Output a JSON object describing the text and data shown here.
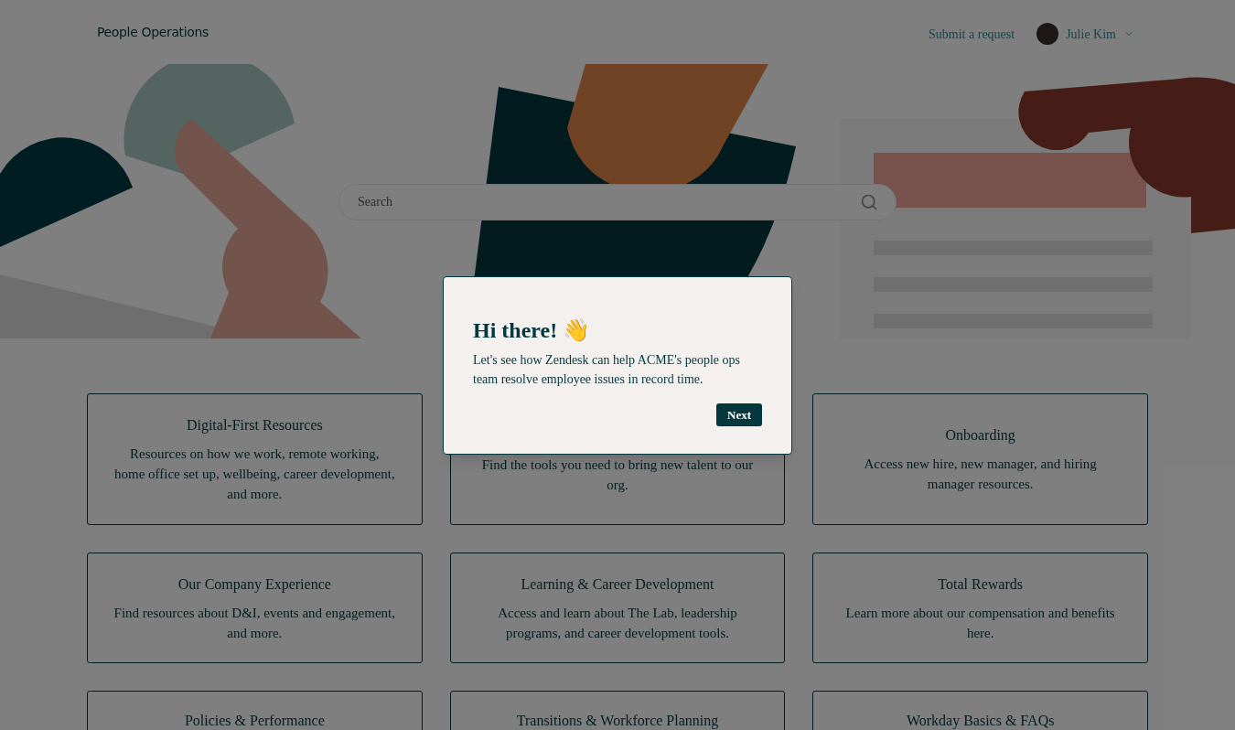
{
  "header": {
    "logo": "People Operations",
    "links": [
      {
        "label": "Submit a request"
      }
    ],
    "user": {
      "name": "Julie Kim"
    }
  },
  "search": {
    "placeholder": "Search"
  },
  "categories": [
    {
      "title": "Digital-First Resources",
      "description": "Resources on how we work, remote working, home office set up, wellbeing, career development, and more."
    },
    {
      "description": "Find the tools you need to bring new talent to our org."
    },
    {
      "title": "Onboarding",
      "description": "Access new hire, new manager, and hiring manager resources."
    },
    {
      "title": "Our Company Experience",
      "description": "Find resources about D&I, events and engagement, and more."
    },
    {
      "title": "Learning & Career Development",
      "description": "Access and learn about The Lab, leadership programs, and career development tools."
    },
    {
      "title": "Total Rewards",
      "description": "Learn more about our compensation and benefits here."
    },
    {
      "title": "Policies & Performance"
    },
    {
      "title": "Transitions & Workforce Planning"
    },
    {
      "title": "Workday Basics & FAQs"
    }
  ],
  "dialog": {
    "title": "Hi there! 👋",
    "message": "Let's see how Zendesk can help ACME's people ops team resolve employee issues in record time.",
    "button": "Next"
  }
}
